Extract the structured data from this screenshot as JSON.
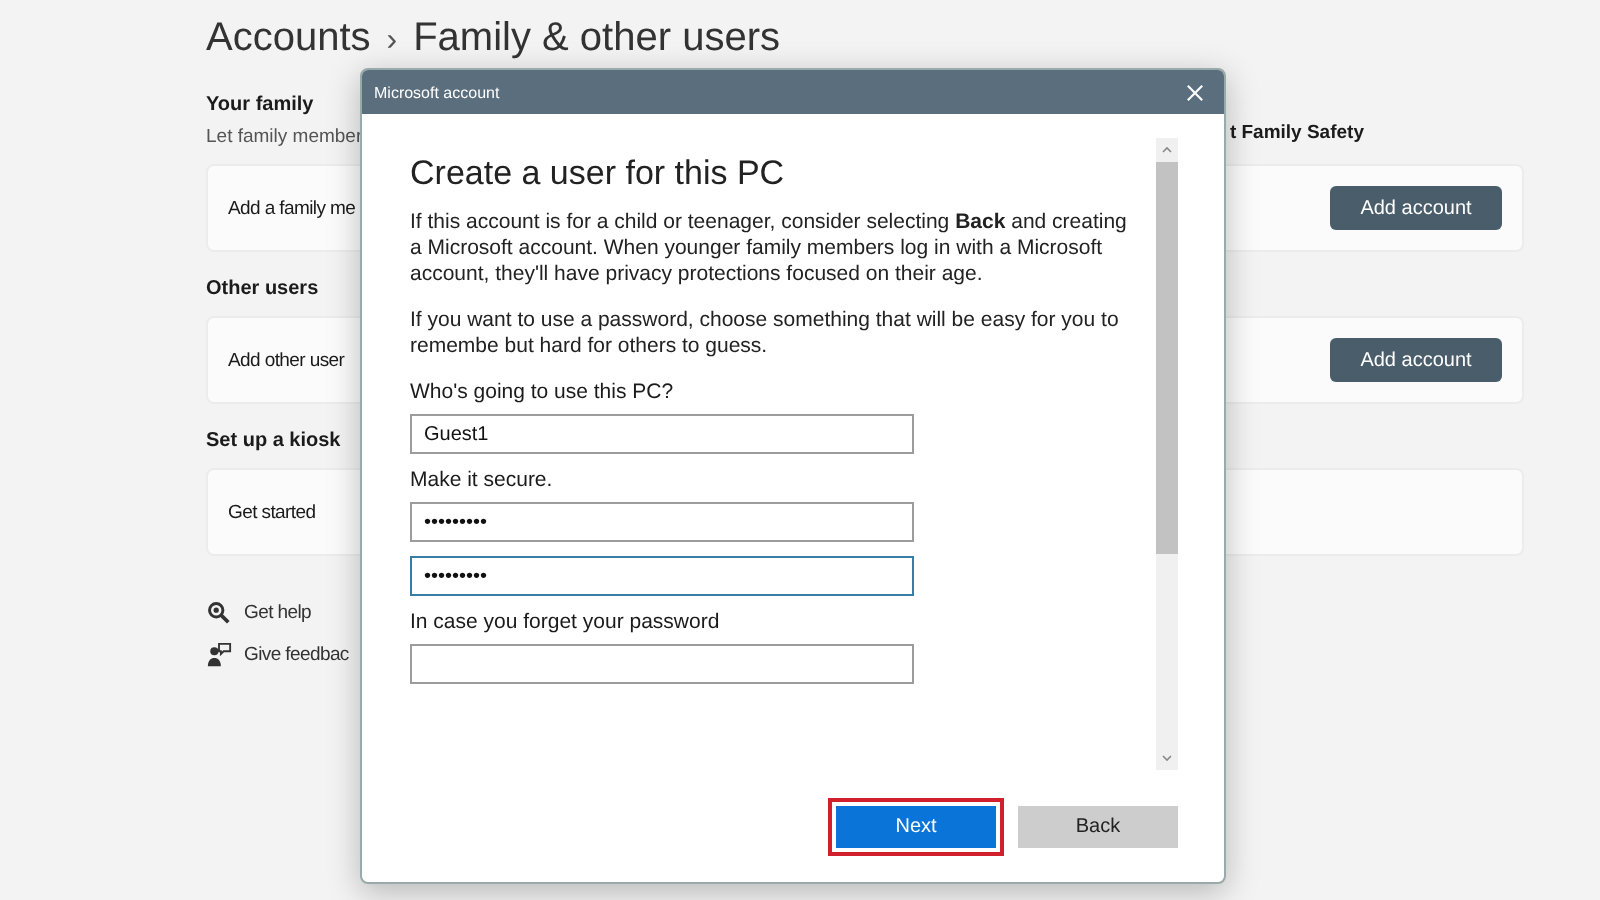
{
  "settings": {
    "breadcrumb_root": "Accounts",
    "separator": "›",
    "title": "Family & other users",
    "sections": [
      {
        "heading": "Your family",
        "description": "Let family member",
        "side_text": "t Family Safety",
        "card": {
          "label": "Add a family me",
          "button": "Add account"
        }
      },
      {
        "heading": "Other users",
        "card": {
          "label": "Add other user",
          "button": "Add account"
        }
      },
      {
        "heading": "Set up a kiosk",
        "card": {
          "label": "Get started"
        }
      }
    ],
    "links": [
      {
        "kind": "help",
        "label": "Get help"
      },
      {
        "kind": "feedback",
        "label": "Give feedbac"
      }
    ]
  },
  "dialog": {
    "title": "Microsoft account",
    "heading": "Create a user for this PC",
    "paragraphs": [
      "If this account is for a child or teenager, consider selecting **Back** and creating a Microsoft account. When younger family members log in with a Microsoft account, they'll have privacy protections focused on their age.",
      "If you want to use a password, choose something that will be easy for you to remembe but hard for others to guess."
    ],
    "fields": [
      {
        "label": "Who's going to use this PC?",
        "inputs": [
          {
            "value": "Guest1",
            "focused": false
          }
        ]
      },
      {
        "label": "Make it secure.",
        "inputs": [
          {
            "value": "•••••••••",
            "focused": false
          },
          {
            "value": "•••••••••",
            "focused": true
          }
        ]
      },
      {
        "label": "In case you forget your password",
        "inputs": [
          {
            "focused": false
          }
        ]
      }
    ],
    "buttons": [
      {
        "label": "Next",
        "kind": "primary",
        "highlighted": true
      },
      {
        "label": "Back",
        "kind": "secondary",
        "highlighted": false
      }
    ]
  }
}
